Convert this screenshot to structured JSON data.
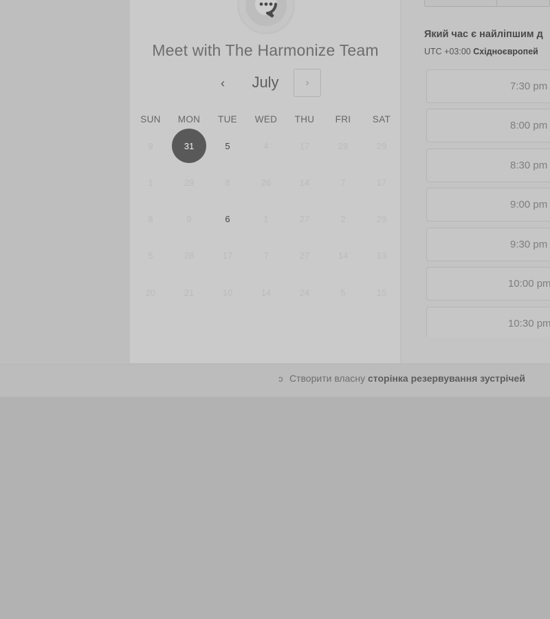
{
  "header": {
    "title": "Meet with The Harmonize Team"
  },
  "calendar": {
    "month": "July",
    "prev_label": "‹",
    "next_label": "›",
    "weekdays": [
      "SUN",
      "MON",
      "TUE",
      "WED",
      "THU",
      "FRI",
      "SAT"
    ],
    "weeks": [
      [
        {
          "d": "9",
          "s": "disabled"
        },
        {
          "d": "31",
          "s": "selected"
        },
        {
          "d": "5",
          "s": "active"
        },
        {
          "d": "4",
          "s": "disabled"
        },
        {
          "d": "17",
          "s": "disabled"
        },
        {
          "d": "29",
          "s": "disabled"
        },
        {
          "d": "29",
          "s": "disabled"
        }
      ],
      [
        {
          "d": "1",
          "s": "disabled"
        },
        {
          "d": "29",
          "s": "disabled"
        },
        {
          "d": "8",
          "s": "disabled"
        },
        {
          "d": "26",
          "s": "disabled"
        },
        {
          "d": "14",
          "s": "disabled"
        },
        {
          "d": "7",
          "s": "disabled"
        },
        {
          "d": "17",
          "s": "disabled"
        }
      ],
      [
        {
          "d": "8",
          "s": "disabled"
        },
        {
          "d": "9",
          "s": "disabled"
        },
        {
          "d": "6",
          "s": "active"
        },
        {
          "d": "1",
          "s": "disabled"
        },
        {
          "d": "27",
          "s": "disabled"
        },
        {
          "d": "2",
          "s": "disabled"
        },
        {
          "d": "29",
          "s": "disabled"
        }
      ],
      [
        {
          "d": "5",
          "s": "disabled"
        },
        {
          "d": "28",
          "s": "disabled"
        },
        {
          "d": "17",
          "s": "disabled"
        },
        {
          "d": "7",
          "s": "disabled"
        },
        {
          "d": "27",
          "s": "disabled"
        },
        {
          "d": "14",
          "s": "disabled"
        },
        {
          "d": "13",
          "s": "disabled"
        }
      ],
      [
        {
          "d": "20",
          "s": "disabled"
        },
        {
          "d": "21",
          "s": "disabled"
        },
        {
          "d": "10",
          "s": "disabled"
        },
        {
          "d": "14",
          "s": "disabled"
        },
        {
          "d": "24",
          "s": "disabled"
        },
        {
          "d": "5",
          "s": "disabled"
        },
        {
          "d": "15",
          "s": "disabled"
        }
      ]
    ]
  },
  "times": {
    "question": "Який час є найліпшим д",
    "timezone_prefix": "UTC +03:00 ",
    "timezone_name": "Східноєвропей",
    "slots": [
      "7:30 pm",
      "8:00 pm",
      "8:30 pm",
      "9:00 pm",
      "9:30 pm",
      "10:00 pm",
      "10:30 pm"
    ]
  },
  "footer": {
    "prefix": "Створити власну ",
    "link": "сторінка резервування зустрічей"
  },
  "icons": {
    "avatar": "chat-bubble-icon",
    "footer": "sprocket-icon"
  },
  "colors": {
    "selected_day": "#595959",
    "page_background": "#b2b2b2"
  }
}
